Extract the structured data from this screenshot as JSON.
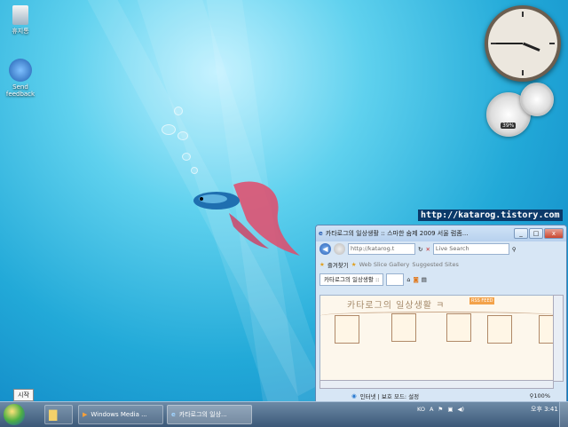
{
  "desktop": {
    "icons": [
      {
        "label": "휴지통",
        "icon": "recycle-bin-icon"
      },
      {
        "label": "Send feedback",
        "icon": "feedback-icon"
      }
    ],
    "watermark_url": "http://katarog.tistory.com",
    "tooltip": "시작"
  },
  "gadgets": {
    "clock": {
      "hour": 3,
      "minute": 45
    },
    "cpu_meter": {
      "label": "39%"
    }
  },
  "ie_window": {
    "title": "카타로그의 일상생활 :: 스마한 숨제 2009 서울 럼좀...",
    "address": "http://katarog.t",
    "search_placeholder": "Live Search",
    "favorites_label": "즐겨찾기",
    "web_slice_label": "Web Slice Gallery",
    "suggested_label": "Suggested Sites",
    "tab_label": "카타로그의 일상생활 ::",
    "blog_title": "카타로그의 일상생활 ㅋ",
    "rss_label": "RSS FEED",
    "status_text": "인터넷 | 보호 모드: 설정",
    "zoom": "100%"
  },
  "taskbar": {
    "buttons": [
      {
        "label": "",
        "icon": "folder-icon"
      },
      {
        "label": "Windows Media ...",
        "icon": "media-player-icon"
      },
      {
        "label": "카타로그의 일상...",
        "icon": "ie-icon"
      }
    ],
    "tray_items": [
      "KO",
      "A"
    ],
    "time": "오후 3:41"
  },
  "colors": {
    "accent": "#2a5fb4",
    "desktop": "#22a9d8",
    "taskbar": "#3b5878"
  }
}
